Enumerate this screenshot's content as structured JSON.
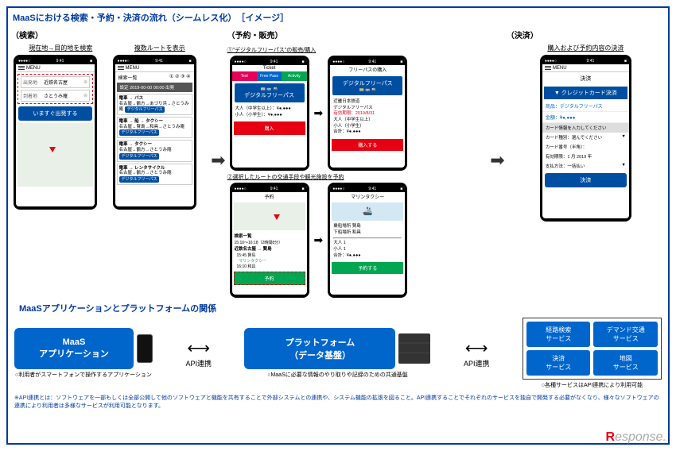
{
  "title_main": "MaaSにおける検索・予約・決済の流れ（シームレス化）　［イメージ］",
  "sections": {
    "search": "（検索）",
    "booking": "（予約・販売）",
    "payment": "（決済）"
  },
  "captions": {
    "search1": "現在地→目的地を検索",
    "search2": "複数ルートを表示",
    "book1": "①\"デジタルフリーパス\"の販売/購入",
    "book2": "②選択したルートの交通手段や観光施設を予約",
    "pay": "購入および予約内容の決済"
  },
  "phone_common": {
    "time": "9:41",
    "signal": "●●●●○",
    "menu": "MENU"
  },
  "search_phone": {
    "from_label": "出発地",
    "from_value": "近鉄名古屋",
    "to_label": "到着地",
    "to_value": "さとうみ庵",
    "button": "いますぐ出発する"
  },
  "routes_phone": {
    "header": "検索一覧",
    "nums": "① ② ③ ④",
    "date": "2019-00-00 00:00 出発",
    "r1_title": "電車 → バス",
    "r1_route": "名古屋→鶴方→あづり浜→さとうみ庵",
    "r2_title": "電車 → 船 → タクシー",
    "r2_route": "名古屋→賢島→和具→さとうみ庵",
    "r3_title": "電車 → タクシー",
    "r3_route": "名古屋→鶴方→さとうみ庵",
    "r4_title": "電車 → レンタサイクル",
    "r4_route": "名古屋→鶴方→さとうみ庵",
    "badge": "デジタルフリーパス"
  },
  "ticket_phone": {
    "header": "Ticket",
    "tab1": "Test",
    "tab2": "Free Pass",
    "tab3": "Activity",
    "pass_name": "デジタルフリーパス",
    "price1": "大人（中学生以上）：¥●,●●●",
    "price2": "小人（小学生）：¥●,●●●",
    "buy": "購入"
  },
  "pass_phone": {
    "header": "フリーパスの購入",
    "pass_name": "デジタルフリーパス",
    "company": "近畿日本鉄道",
    "pass_sub": "デジタルフリーパス",
    "expire": "有効期限：2019/8/31",
    "adult": "大人（中学生以上）",
    "child": "小人（小学生）",
    "total": "合計：¥●,●●●",
    "buy": "購入する"
  },
  "reserve_phone": {
    "header": "予約",
    "list_header": "検索一覧",
    "time_range": "15:10〜16:18（2時間8分）",
    "route": "近鉄名古屋 → 賢島",
    "leg1": "15:45 賢島",
    "leg1_mode": "マリンタクシー",
    "leg2": "16:10 和具",
    "button": "予約"
  },
  "taxi_phone": {
    "header": "マリンタクシー",
    "from_label": "乗船場所",
    "from_value": "賢島",
    "to_label": "下船場所",
    "to_value": "和具",
    "adult": "大人 1",
    "child": "小人 1",
    "total": "合計：¥●,●●●",
    "button": "予約する"
  },
  "payment_phone": {
    "header": "決済",
    "method": "▼ クレジットカード決済",
    "item_label": "商品：デジタルフリーパス",
    "amount_label": "金額：¥●,●●●",
    "card_info": "カード情報を入力してください",
    "card_type": "カード種別：選んでください",
    "card_no": "カード番号（半角）：",
    "expire": "有効期限：1 月 2019 年",
    "pay_method": "支払方法：一括払い",
    "button": "決済"
  },
  "platform_title": "MaaSアプリケーションとプラットフォームの関係",
  "platform": {
    "app": "MaaS\nアプリケーション",
    "app_note": "○利用者がスマートフォンで操作するアプリケーション",
    "plat": "プラットフォーム\n（データ基盤）",
    "plat_note": "○MaaSに必要な情報のやり取りや記録のための共通基盤",
    "api": "API連携",
    "svc1": "経路検索\nサービス",
    "svc2": "デマンド交通\nサービス",
    "svc3": "決済\nサービス",
    "svc4": "地図\nサービス",
    "svc_note": "○各種サービスはAPI連携により利用可能"
  },
  "footnote": "※API連携とは：ソフトウェアを一部もしくは全部公開して他のソフトウェアと機能を共有することで外部システムとの連携や、システム機能の拡張を図ること。API連携することでそれぞれのサービスを独自で開発する必要がなくなり、様々なソフトウェアの連携により利用者は多様なサービスが利用可能となります。",
  "watermark": "Response."
}
